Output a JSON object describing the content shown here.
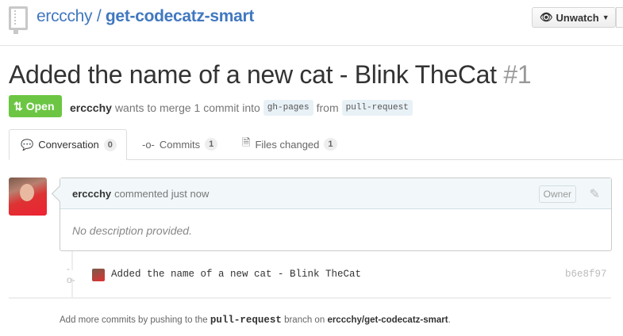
{
  "repo": {
    "owner": "erccchy",
    "separator": "/",
    "name": "get-codecatz-smart"
  },
  "header": {
    "unwatch_label": "Unwatch"
  },
  "pr": {
    "title": "Added the name of a new cat - Blink TheCat",
    "number": "#1",
    "state": "Open",
    "author": "erccchy",
    "merge_text": "wants to merge 1 commit into",
    "base": "gh-pages",
    "from_text": "from",
    "head": "pull-request"
  },
  "tabs": [
    {
      "label": "Conversation",
      "count": "0"
    },
    {
      "label": "Commits",
      "count": "1"
    },
    {
      "label": "Files changed",
      "count": "1"
    }
  ],
  "comment": {
    "author": "erccchy",
    "action": "commented just now",
    "role": "Owner",
    "body": "No description provided."
  },
  "commit": {
    "message": "Added the name of a new cat - Blink TheCat",
    "sha": "b6e8f97"
  },
  "footer": {
    "pre": "Add more commits by pushing to the",
    "branch": "pull-request",
    "mid": "branch on",
    "repo": "erccchy/get-codecatz-smart",
    "end": "."
  }
}
